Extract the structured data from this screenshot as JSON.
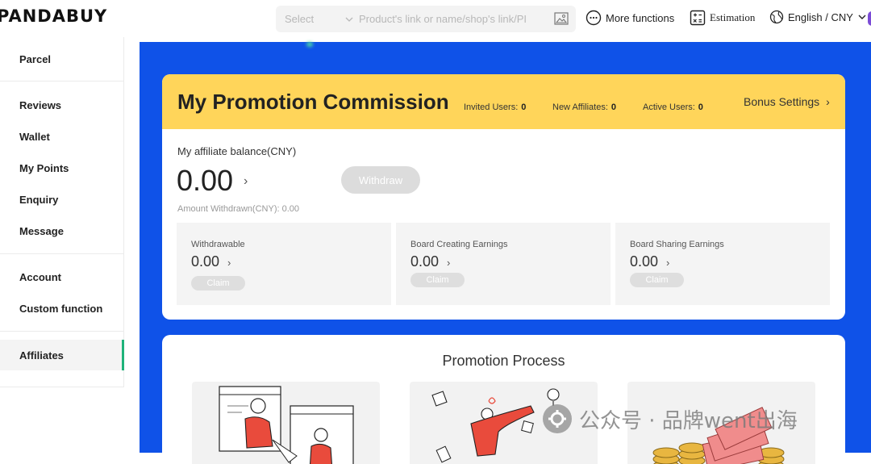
{
  "header": {
    "logo": "PANDABUY",
    "search_select": "Select",
    "search_placeholder": "Product's link or name/shop's link/PI",
    "more_functions": "More functions",
    "estimation": "Estimation",
    "language": "English / CNY"
  },
  "sidebar": {
    "items": [
      "Parcel",
      "Reviews",
      "Wallet",
      "My Points",
      "Enquiry",
      "Message",
      "Account",
      "Custom function",
      "Affiliates"
    ],
    "active": "Affiliates",
    "accent": "#1fb37a"
  },
  "commission": {
    "title": "My Promotion Commission",
    "invited_label": "Invited Users:",
    "invited_value": "0",
    "new_aff_label": "New Affiliates:",
    "new_aff_value": "0",
    "active_label": "Active Users:",
    "active_value": "0",
    "bonus_settings": "Bonus Settings",
    "balance_label": "My affiliate balance(CNY)",
    "balance_value": "0.00",
    "withdraw_button": "Withdraw",
    "amount_withdrawn": "Amount Withdrawn(CNY):  0.00",
    "earnings": [
      {
        "label": "Withdrawable",
        "value": "0.00",
        "claim": "Claim"
      },
      {
        "label": "Board Creating Earnings",
        "value": "0.00",
        "claim": "Claim"
      },
      {
        "label": "Board Sharing Earnings",
        "value": "0.00",
        "claim": "Claim"
      }
    ]
  },
  "process": {
    "title": "Promotion Process"
  },
  "watermark": "公众号 · 品牌went出海",
  "colors": {
    "primary_blue": "#0f52e8",
    "header_yellow": "#ffd55a"
  }
}
